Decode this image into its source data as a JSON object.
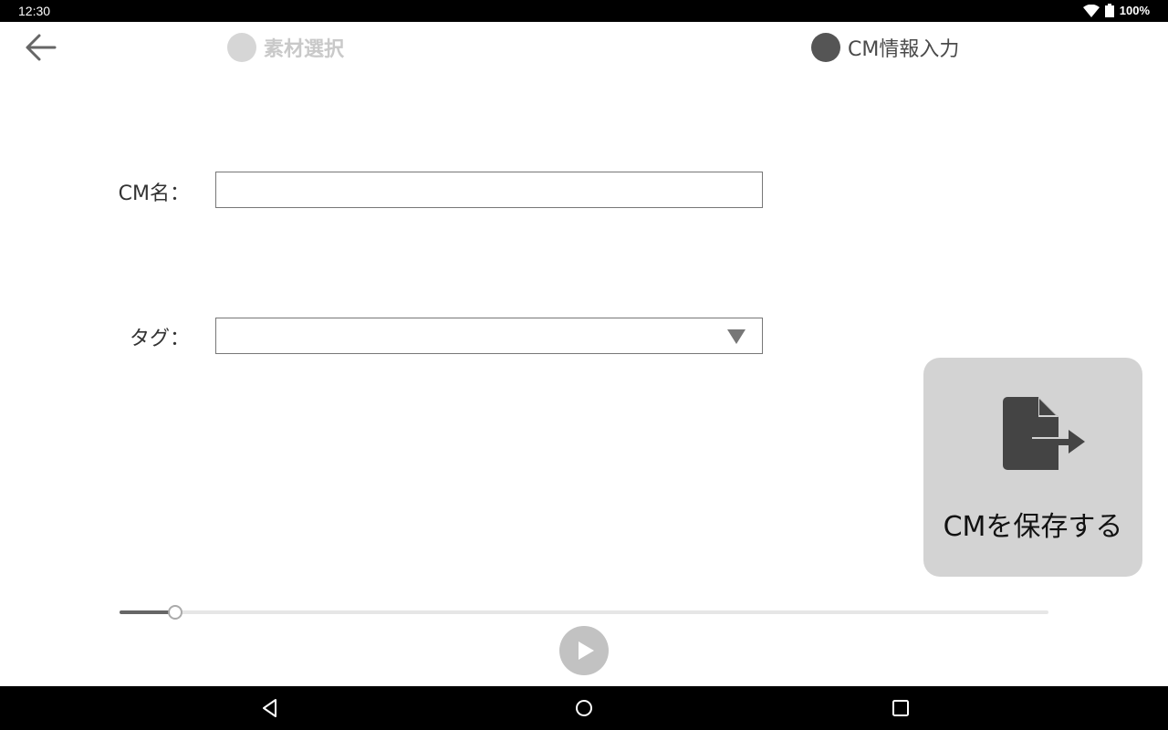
{
  "status_bar": {
    "time": "12:30",
    "battery": "100%"
  },
  "steps": [
    {
      "label": "素材選択",
      "state": "inactive"
    },
    {
      "label": "CM情報入力",
      "state": "active"
    }
  ],
  "form": {
    "name_label": "CM名：",
    "name_value": "",
    "tag_label": "タグ：",
    "tag_value": ""
  },
  "save_button": {
    "label": "CMを保存する",
    "icon": "file-export-icon"
  },
  "player": {
    "progress_fraction": 0.06
  },
  "colors": {
    "active_step": "#555555",
    "inactive_step": "#d6d6d6",
    "button_bg": "#d3d3d3"
  }
}
